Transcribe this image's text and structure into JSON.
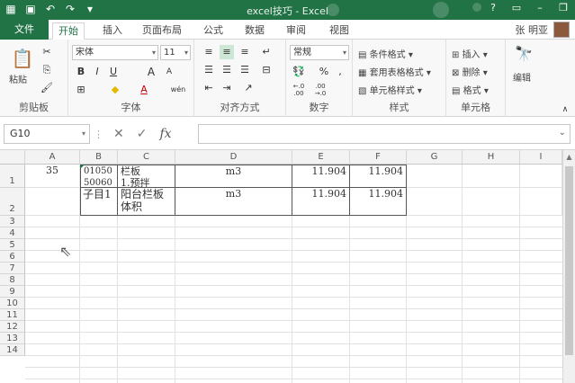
{
  "window": {
    "title": "excel技巧 - Excel"
  },
  "qat": {
    "undo": "↶",
    "redo": "↷"
  },
  "tabs": [
    "文件",
    "开始",
    "插入",
    "页面布局",
    "公式",
    "数据",
    "审阅",
    "视图"
  ],
  "user": {
    "name": "张 明亚"
  },
  "ribbon": {
    "clipboard": {
      "label": "剪贴板",
      "paste": "粘贴"
    },
    "font": {
      "label": "字体",
      "name": "宋体",
      "size": "11",
      "bold": "B",
      "italic": "I",
      "underline": "U",
      "grow": "A",
      "shrink": "A",
      "phonetic": "wén"
    },
    "align": {
      "label": "对齐方式"
    },
    "number": {
      "label": "数字",
      "format": "常规",
      "percent": "%",
      "comma": ",",
      "inc": "←.0\n.00",
      "dec": ".00\n→.0"
    },
    "styles": {
      "label": "样式",
      "cond": "条件格式",
      "table": "套用表格格式",
      "cell": "单元格样式"
    },
    "cells": {
      "label": "单元格",
      "insert": "插入",
      "delete": "删除",
      "format": "格式"
    },
    "edit": {
      "label": "编辑"
    }
  },
  "formula_bar": {
    "name_box": "G10",
    "cancel": "✕",
    "enter": "✓",
    "fx": "fx",
    "value": ""
  },
  "columns": [
    "A",
    "B",
    "C",
    "D",
    "E",
    "F",
    "G",
    "H",
    "I"
  ],
  "rows": [
    "1",
    "2",
    "3",
    "4",
    "5",
    "6",
    "7",
    "8",
    "9",
    "10",
    "11",
    "12",
    "13",
    "14"
  ],
  "cells": {
    "A1": "35",
    "B1": "01050",
    "B1b": "50060",
    "C1": "栏板",
    "C1b": "1.预拌",
    "D1": "m3",
    "E1": "11.904",
    "F1": "11.904",
    "B2": "子目1",
    "C2": "阳台栏板",
    "C2b": "体积",
    "D2": "m3",
    "E2": "11.904",
    "F2": "11.904"
  }
}
